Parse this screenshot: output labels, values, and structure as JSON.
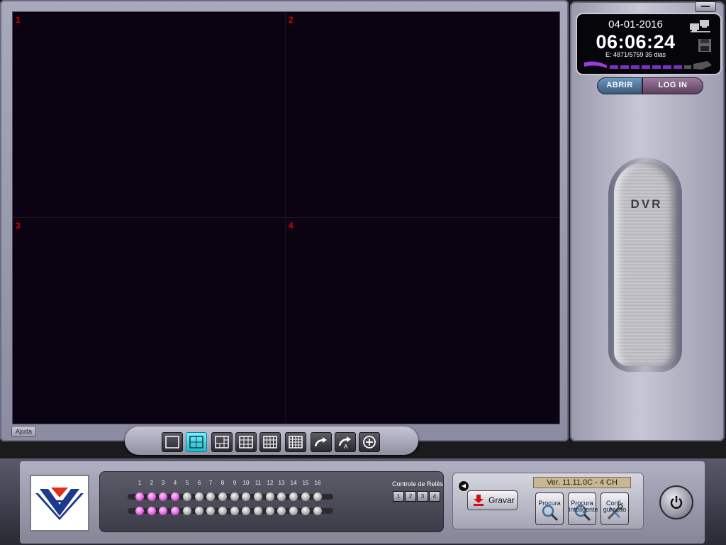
{
  "video": {
    "channels": [
      "1",
      "2",
      "3",
      "4"
    ],
    "help_label": "Ajuda"
  },
  "layout_toolbar": {
    "buttons": [
      "single-view",
      "quad-view",
      "six-view",
      "nine-view",
      "twelve-view",
      "sixteen-view",
      "next-page",
      "auto-cycle",
      "zoom"
    ],
    "active": "quad-view"
  },
  "status_panel": {
    "date": "04-01-2016",
    "time": "06:06:24",
    "disk_info": "E: 4871/5759  35 dias"
  },
  "buttons": {
    "open": "ABRIR",
    "login": "LOG IN"
  },
  "dvr_lever": {
    "label": "DVR"
  },
  "camera_leds": {
    "numbers": [
      "1",
      "2",
      "3",
      "4",
      "5",
      "6",
      "7",
      "8",
      "9",
      "10",
      "11",
      "12",
      "13",
      "14",
      "15",
      "16"
    ],
    "active_count": 4
  },
  "relay_control": {
    "title": "Controle de Relês",
    "buttons": [
      "1",
      "2",
      "3",
      "4"
    ]
  },
  "actions": {
    "version": "Ver. 11.11.0C - 4 CH",
    "record": "Gravar",
    "search": "Procura",
    "smart_search": "Procura Inteligente",
    "config": "Confi- guração"
  },
  "colors": {
    "video_bg": "#0b0212",
    "channel_label": "#e00000",
    "active_layout": "#45d6e8",
    "led_on": "#e05ae0"
  }
}
